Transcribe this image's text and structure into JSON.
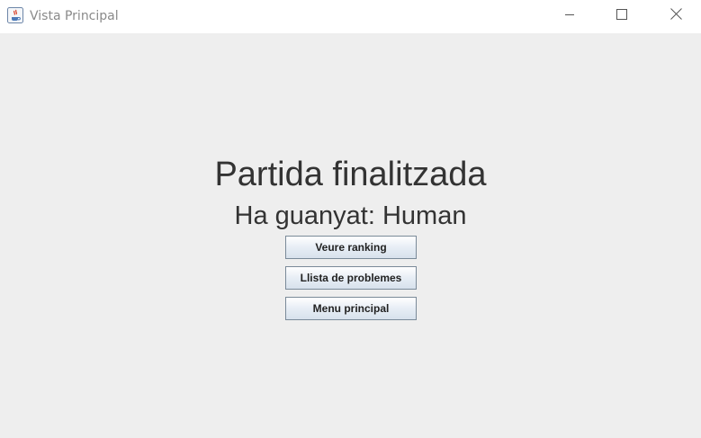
{
  "window": {
    "title": "Vista Principal",
    "icon": "java-icon",
    "controls": [
      "minimize-icon",
      "maximize-icon",
      "close-icon"
    ]
  },
  "main": {
    "heading": "Partida finalitzada",
    "result": "Ha guanyat: Human",
    "buttons": {
      "ranking": "Veure ranking",
      "problems": "Llista de problemes",
      "menu": "Menu principal"
    }
  }
}
